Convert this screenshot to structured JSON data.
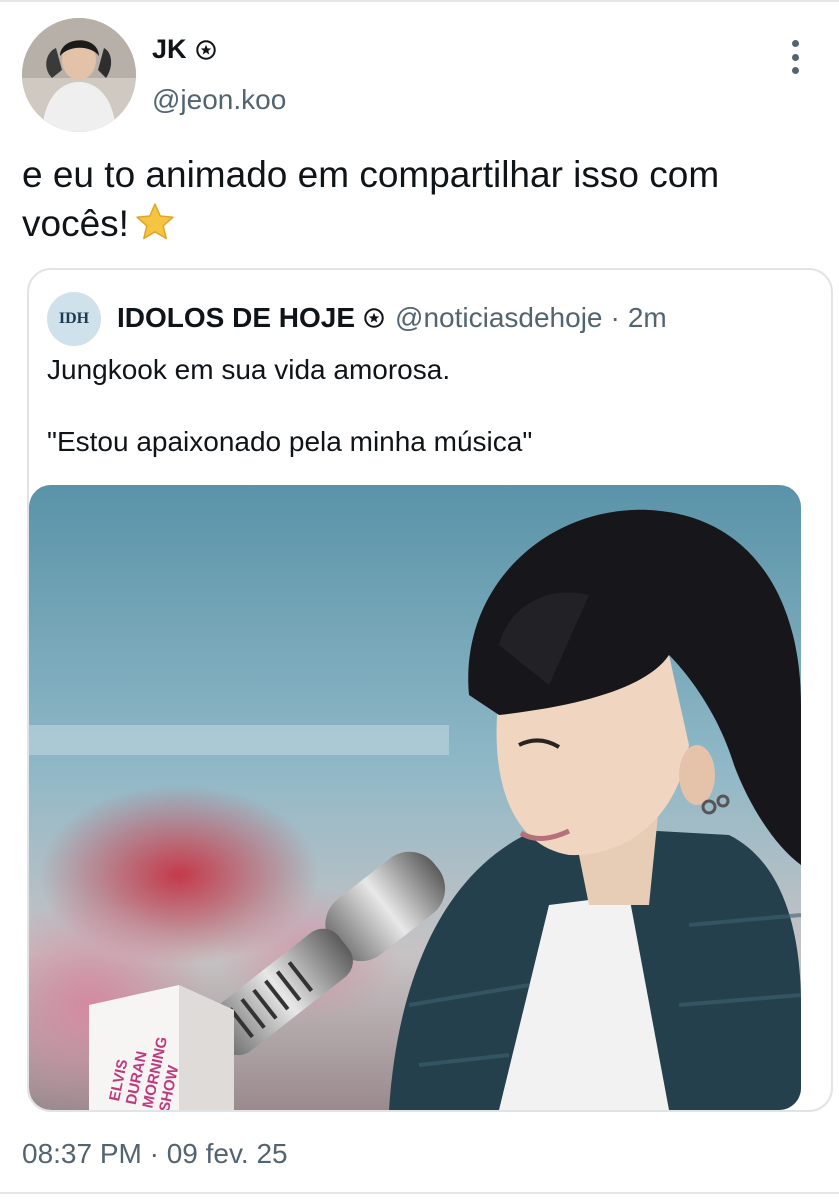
{
  "author": {
    "display_name": "JK",
    "handle": "@jeon.koo",
    "verified_icon": "verified-badge-icon"
  },
  "tweet": {
    "text": "e eu to animado em compartilhar isso com vocês!",
    "emoji": "star-emoji-icon"
  },
  "quoted": {
    "avatar_text": "IDH",
    "display_name": "IDOLOS DE HOJE",
    "handle": "@noticiasdehoje",
    "separator": "·",
    "age": "2m",
    "line1": "Jungkook em sua vida amorosa.",
    "line2": "\"Estou apaixonado pela minha música\""
  },
  "photo": {
    "mic_flag_lines": [
      "ELVIS",
      "DURAN",
      "MORNING",
      "SHOW"
    ]
  },
  "footer": {
    "timestamp": "08:37 PM · 09 fev. 25"
  },
  "colors": {
    "text_primary": "#0f1419",
    "text_secondary": "#536471",
    "border": "#e1e4e7",
    "star": "#f5c542"
  }
}
